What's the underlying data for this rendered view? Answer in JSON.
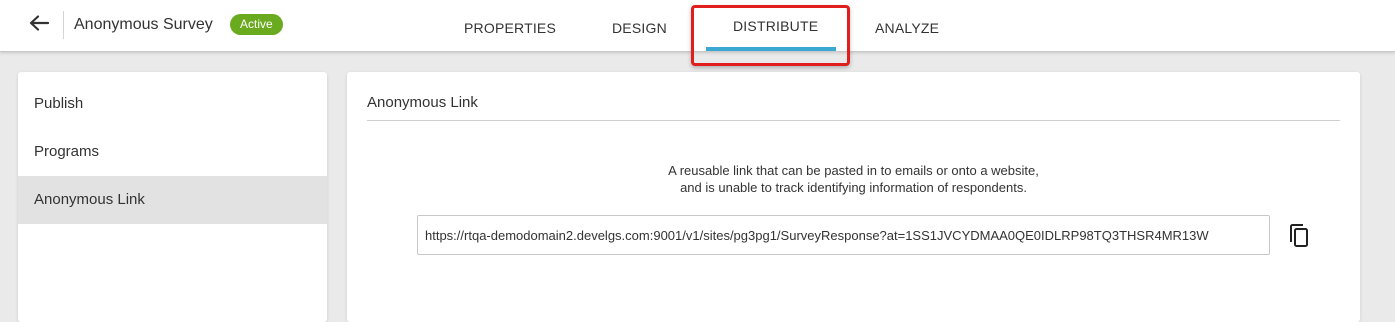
{
  "header": {
    "back_icon": "arrow-left-icon",
    "survey_title": "Anonymous Survey",
    "status_badge": "Active",
    "status_color": "#6aaa1f",
    "tabs": [
      {
        "label": "PROPERTIES"
      },
      {
        "label": "DESIGN"
      },
      {
        "label": "DISTRIBUTE",
        "active": true
      },
      {
        "label": "ANALYZE"
      }
    ],
    "active_tab_color": "#3ba7d3",
    "highlight_color": "#e01e1e"
  },
  "sidebar": {
    "items": [
      {
        "label": "Publish"
      },
      {
        "label": "Programs"
      },
      {
        "label": "Anonymous Link",
        "active": true
      }
    ]
  },
  "main": {
    "title": "Anonymous Link",
    "description_line1": "A reusable link that can be pasted in to emails or onto a website,",
    "description_line2": "and is unable to track identifying information of respondents.",
    "link_value": "https://rtqa-demodomain2.develgs.com:9001/v1/sites/pg3pg1/SurveyResponse?at=1SS1JVCYDMAA0QE0IDLRP98TQ3THSR4MR13W",
    "copy_icon": "copy-icon"
  }
}
